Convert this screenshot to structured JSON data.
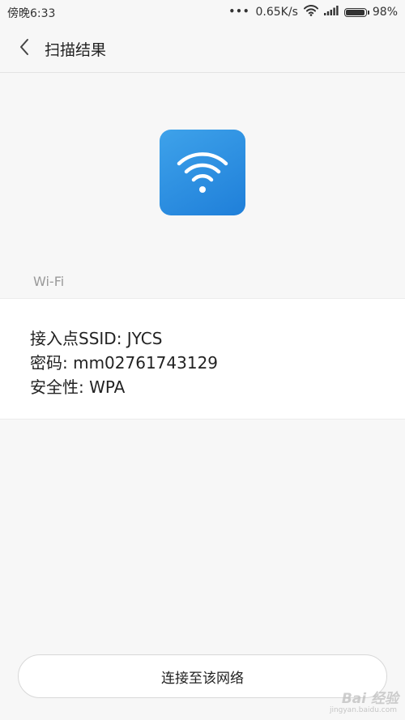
{
  "status_bar": {
    "time": "傍晚6:33",
    "dots": "•••",
    "network_speed": "0.65K/s",
    "battery_percent": "98%",
    "battery_level": 0.98,
    "icons": [
      "wifi-icon",
      "signal-icon",
      "battery-icon"
    ]
  },
  "header": {
    "title": "扫描结果",
    "back_icon": "chevron-left-icon"
  },
  "network": {
    "icon": "wifi-icon",
    "accent_color": "#2b8fe3",
    "section_label": "Wi-Fi",
    "ssid_line": "接入点SSID: JYCS",
    "password_line": "密码: mm02761743129",
    "security_line": "安全性: WPA"
  },
  "actions": {
    "connect_label": "连接至该网络"
  },
  "watermark": {
    "text": "Bai 经验",
    "sub": "jingyan.baidu.com"
  }
}
